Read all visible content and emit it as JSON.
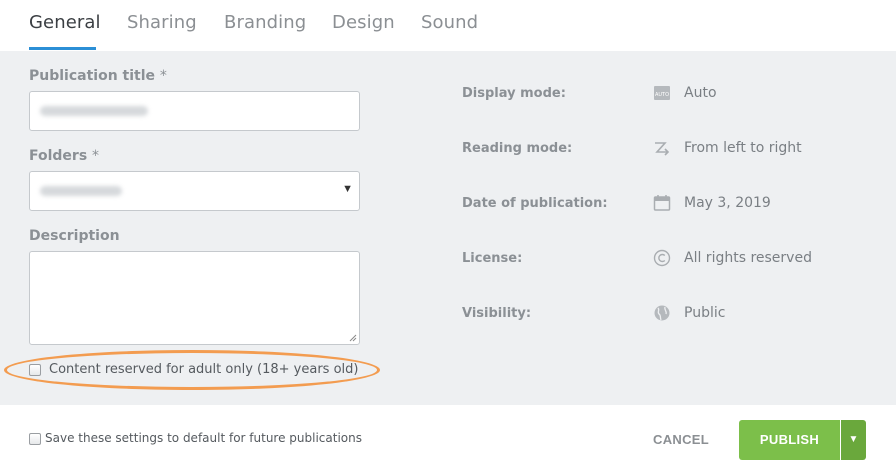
{
  "tabs": [
    {
      "label": "General",
      "active": true
    },
    {
      "label": "Sharing",
      "active": false
    },
    {
      "label": "Branding",
      "active": false
    },
    {
      "label": "Design",
      "active": false
    },
    {
      "label": "Sound",
      "active": false
    }
  ],
  "form": {
    "title_label": "Publication title",
    "required_mark": "*",
    "folders_label": "Folders",
    "folder_arrow": "▼",
    "description_label": "Description",
    "adult_checkbox_label": "Content reserved for adult only (18+ years old)"
  },
  "details": [
    {
      "label": "Display mode:",
      "icon": "auto-icon",
      "value": "Auto"
    },
    {
      "label": "Reading mode:",
      "icon": "reading-direction-icon",
      "value": "From left to right"
    },
    {
      "label": "Date of publication:",
      "icon": "calendar-icon",
      "value": "May 3, 2019"
    },
    {
      "label": "License:",
      "icon": "copyright-icon",
      "value": "All rights reserved"
    },
    {
      "label": "Visibility:",
      "icon": "globe-icon",
      "value": "Public"
    }
  ],
  "auto_icon_text": "AUTO",
  "footer": {
    "save_default_label": "Save these settings to default for future publications",
    "cancel_label": "CANCEL",
    "publish_label": "PUBLISH",
    "publish_caret": "▼"
  },
  "colors": {
    "accent_tab": "#2b8fd6",
    "publish_green": "#7cbf4a",
    "highlight_orange": "#f39c50",
    "panel_bg": "#eef0f2"
  }
}
